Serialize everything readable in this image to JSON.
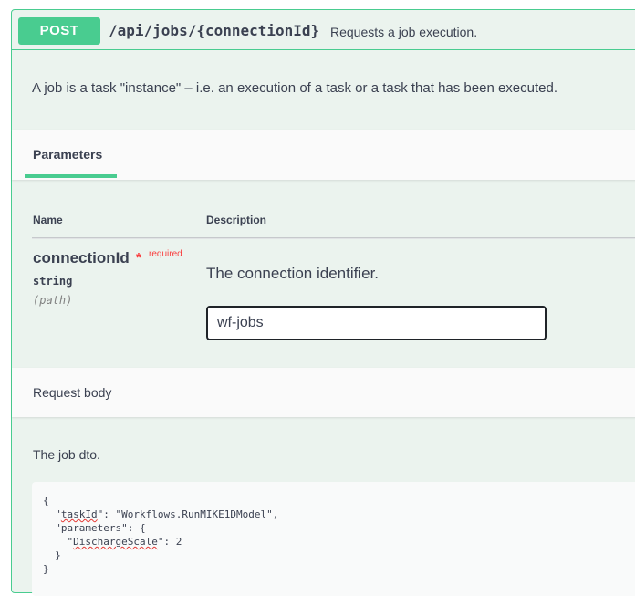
{
  "operation": {
    "method": "POST",
    "path": "/api/jobs/{connectionId}",
    "summary": "Requests a job execution.",
    "description": "A job is a task \"instance\" – i.e. an execution of a task or a task that has been executed."
  },
  "parameters": {
    "tab_label": "Parameters",
    "columns": {
      "name": "Name",
      "description": "Description"
    },
    "items": [
      {
        "name": "connectionId",
        "required_star": "*",
        "required_label": "required",
        "type": "string",
        "in": "(path)",
        "description": "The connection identifier.",
        "value": "wf-jobs"
      }
    ]
  },
  "request_body": {
    "title": "Request body",
    "description": "The job dto.",
    "example": {
      "line1": "{",
      "taskId_key": "taskId",
      "taskId_value": "\"Workflows.RunMIKE1DModel\",",
      "parameters_key": "parameters",
      "parameters_open": ": {",
      "discharge_key": "DischargeScale",
      "discharge_value": ": 2",
      "inner_close": "}",
      "outer_close": "}"
    }
  },
  "colors": {
    "post_accent": "#49cc90",
    "post_background": "#ebf3ee",
    "required_red": "#f93e3e"
  }
}
